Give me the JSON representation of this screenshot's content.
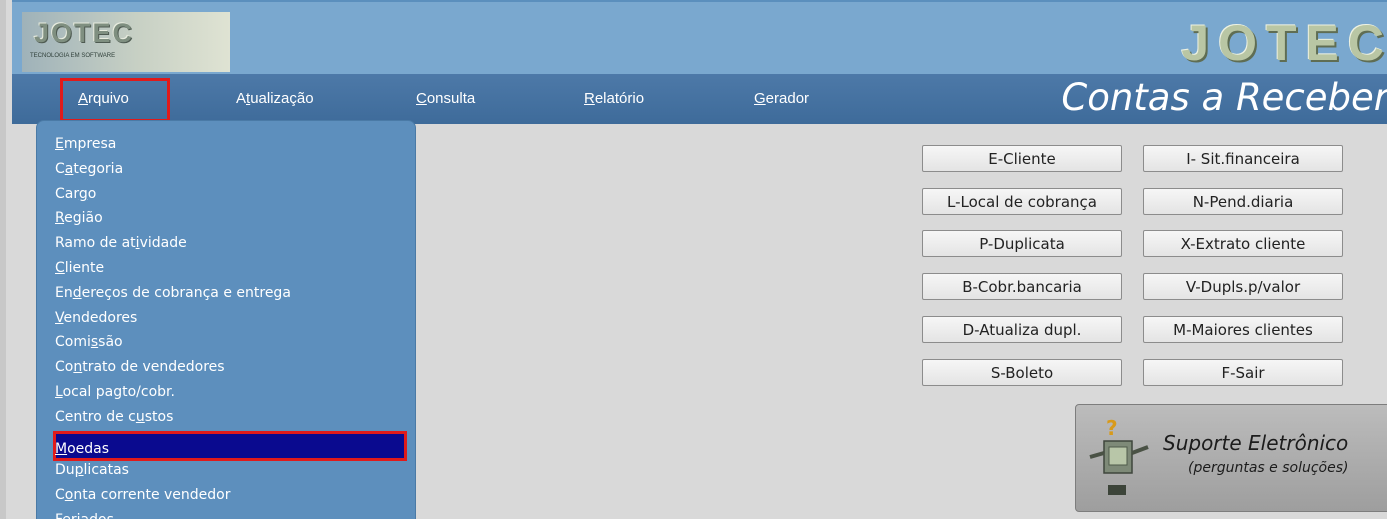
{
  "header": {
    "logo_text": "JOTEC",
    "logo_tagline": "TECNOLOGIA EM SOFTWARE",
    "brand_text": "JOTEC"
  },
  "menubar": {
    "items": [
      {
        "prefix": "",
        "accel": "A",
        "rest": "rquivo"
      },
      {
        "prefix": "A",
        "accel": "t",
        "rest": "ualização"
      },
      {
        "prefix": "",
        "accel": "C",
        "rest": "onsulta"
      },
      {
        "prefix": "",
        "accel": "R",
        "rest": "elatório"
      },
      {
        "prefix": "",
        "accel": "G",
        "rest": "erador"
      }
    ],
    "page_title": "Contas a Receber"
  },
  "dropdown": {
    "items": [
      {
        "prefix": "",
        "accel": "E",
        "rest": "mpresa"
      },
      {
        "prefix": "C",
        "accel": "a",
        "rest": "tegoria"
      },
      {
        "prefix": "Car",
        "accel": "g",
        "rest": "o"
      },
      {
        "prefix": "",
        "accel": "R",
        "rest": "egião"
      },
      {
        "prefix": "Ramo de at",
        "accel": "i",
        "rest": "vidade"
      },
      {
        "prefix": "",
        "accel": "C",
        "rest": "liente"
      },
      {
        "prefix": "En",
        "accel": "d",
        "rest": "ereços de cobrança e entrega"
      },
      {
        "prefix": "",
        "accel": "V",
        "rest": "endedores"
      },
      {
        "prefix": "Comi",
        "accel": "s",
        "rest": "são"
      },
      {
        "prefix": "Co",
        "accel": "n",
        "rest": "trato de vendedores"
      },
      {
        "prefix": "",
        "accel": "L",
        "rest": "ocal pagto/cobr."
      },
      {
        "prefix": "Centro de c",
        "accel": "u",
        "rest": "stos"
      },
      {
        "prefix": "",
        "accel": "M",
        "rest": "oedas"
      },
      {
        "prefix": "Du",
        "accel": "p",
        "rest": "licatas"
      },
      {
        "prefix": "C",
        "accel": "o",
        "rest": "nta corrente vendedor"
      },
      {
        "prefix": "",
        "accel": "F",
        "rest": "eriados"
      }
    ],
    "selected_index": 12
  },
  "buttons": [
    {
      "label": "E-Cliente"
    },
    {
      "label": "I- Sit.financeira"
    },
    {
      "label": "L-Local de cobrança"
    },
    {
      "label": "N-Pend.diaria"
    },
    {
      "label": "P-Duplicata"
    },
    {
      "label": "X-Extrato cliente"
    },
    {
      "label": "B-Cobr.bancaria"
    },
    {
      "label": "V-Dupls.p/valor"
    },
    {
      "label": "D-Atualiza dupl."
    },
    {
      "label": "M-Maiores clientes"
    },
    {
      "label": "S-Boleto"
    },
    {
      "label": "F-Sair"
    }
  ],
  "support": {
    "title": "Suporte Eletrônico",
    "subtitle": "(perguntas e soluções)",
    "icon": "help-robot-icon"
  },
  "colors": {
    "header_bg": "#7aa8cf",
    "menubar_bg": "#4372a3",
    "dropdown_bg": "#5d8fbd",
    "selected_bg": "#0a0a8f",
    "highlight_border": "#e11a1a",
    "content_bg": "#d9d9d9"
  }
}
